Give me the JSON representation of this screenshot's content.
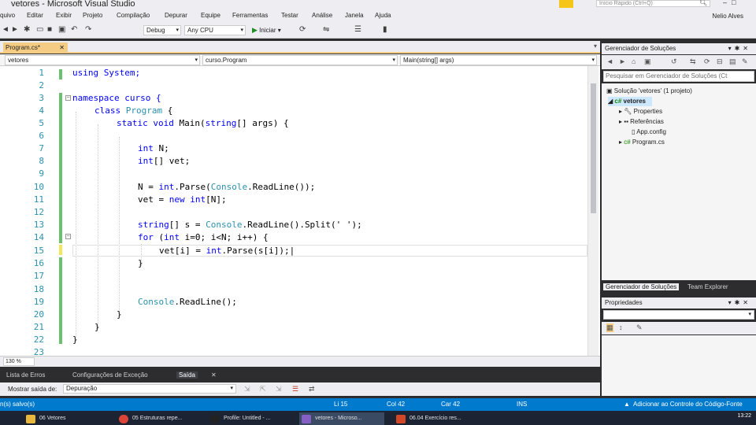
{
  "window": {
    "title": "vetores - Microsoft Visual Studio",
    "quick_launch_placeholder": "Início Rápido (Ctrl+Q)"
  },
  "menu": [
    "quivo",
    "Editar",
    "Exibir",
    "Projeto",
    "Compilação",
    "Depurar",
    "Equipe",
    "Ferramentas",
    "Testar",
    "Análise",
    "Janela",
    "Ajuda"
  ],
  "user": "Nelio Alves",
  "toolbar": {
    "config": "Debug",
    "platform": "Any CPU",
    "start_label": "Iniciar"
  },
  "editor": {
    "tab_label": "Program.cs*",
    "nav": {
      "project": "vetores",
      "class": "curso.Program",
      "member": "Main(string[] args)"
    },
    "zoom": "130 %",
    "line_numbers": [
      "1",
      "2",
      "3",
      "4",
      "5",
      "6",
      "7",
      "8",
      "9",
      "10",
      "11",
      "12",
      "13",
      "14",
      "15",
      "16",
      "17",
      "18",
      "19",
      "20",
      "21",
      "22",
      "23"
    ],
    "lines": {
      "l1": "using System;",
      "l3": "namespace curso {",
      "l4a": "class ",
      "l4b": "Program",
      "l4c": " {",
      "l5a": "static void ",
      "l5b": "Main(",
      "l5c": "string",
      "l5d": "[] args) {",
      "l7a": "int",
      "l7b": " N;",
      "l8a": "int",
      "l8b": "[] vet;",
      "l10a": "N = ",
      "l10b": "int",
      "l10c": ".Parse(",
      "l10d": "Console",
      "l10e": ".ReadLine());",
      "l11a": "vet = ",
      "l11b": "new int",
      "l11c": "[N];",
      "l13a": "string",
      "l13b": "[] s = ",
      "l13c": "Console",
      "l13d": ".ReadLine().Split(' ');",
      "l14a": "for",
      "l14b": " (",
      "l14c": "int",
      "l14d": " i=0; i<N; i++) {",
      "l15a": "vet[i] = ",
      "l15b": "int",
      "l15c": ".Parse(s[i]);",
      "l16": "}",
      "l19a": "Console",
      "l19b": ".ReadLine();",
      "l20": "}",
      "l21": "}",
      "l22": "}"
    }
  },
  "bottom_panel": {
    "tabs": [
      "Lista de Erros",
      "Configurações de Exceção",
      "Saída"
    ],
    "show_output_label": "Mostrar saída de:",
    "output_source": "Depuração"
  },
  "solution_explorer": {
    "title": "Gerenciador de Soluções",
    "search_placeholder": "Pesquisar em Gerenciador de Soluções (Ct",
    "solution": "Solução 'vetores' (1 projeto)",
    "project": "vetores",
    "items": [
      "Properties",
      "Referências",
      "App.config",
      "Program.cs"
    ],
    "tabs": [
      "Gerenciador de Soluções",
      "Team Explorer"
    ]
  },
  "properties": {
    "title": "Propriedades"
  },
  "status": {
    "left": "n(s) salvo(s)",
    "line": "Li 15",
    "col": "Col 42",
    "car": "Car 42",
    "mode": "INS",
    "source_control": "Adicionar ao Controle do Código-Fonte"
  },
  "taskbar": {
    "items": [
      "06 Vetores",
      "05 Estruturas repe...",
      "Profile: Untitled - ...",
      "vetores - Microso...",
      "06.04 Exercício res..."
    ],
    "clock": "13:22"
  },
  "colors": {
    "accent": "#007acc",
    "tab_active": "#f5cc84",
    "keyword": "#0000ff",
    "type": "#2b91af",
    "change_saved": "#6cc16c",
    "change_unsaved": "#f2e65a"
  }
}
